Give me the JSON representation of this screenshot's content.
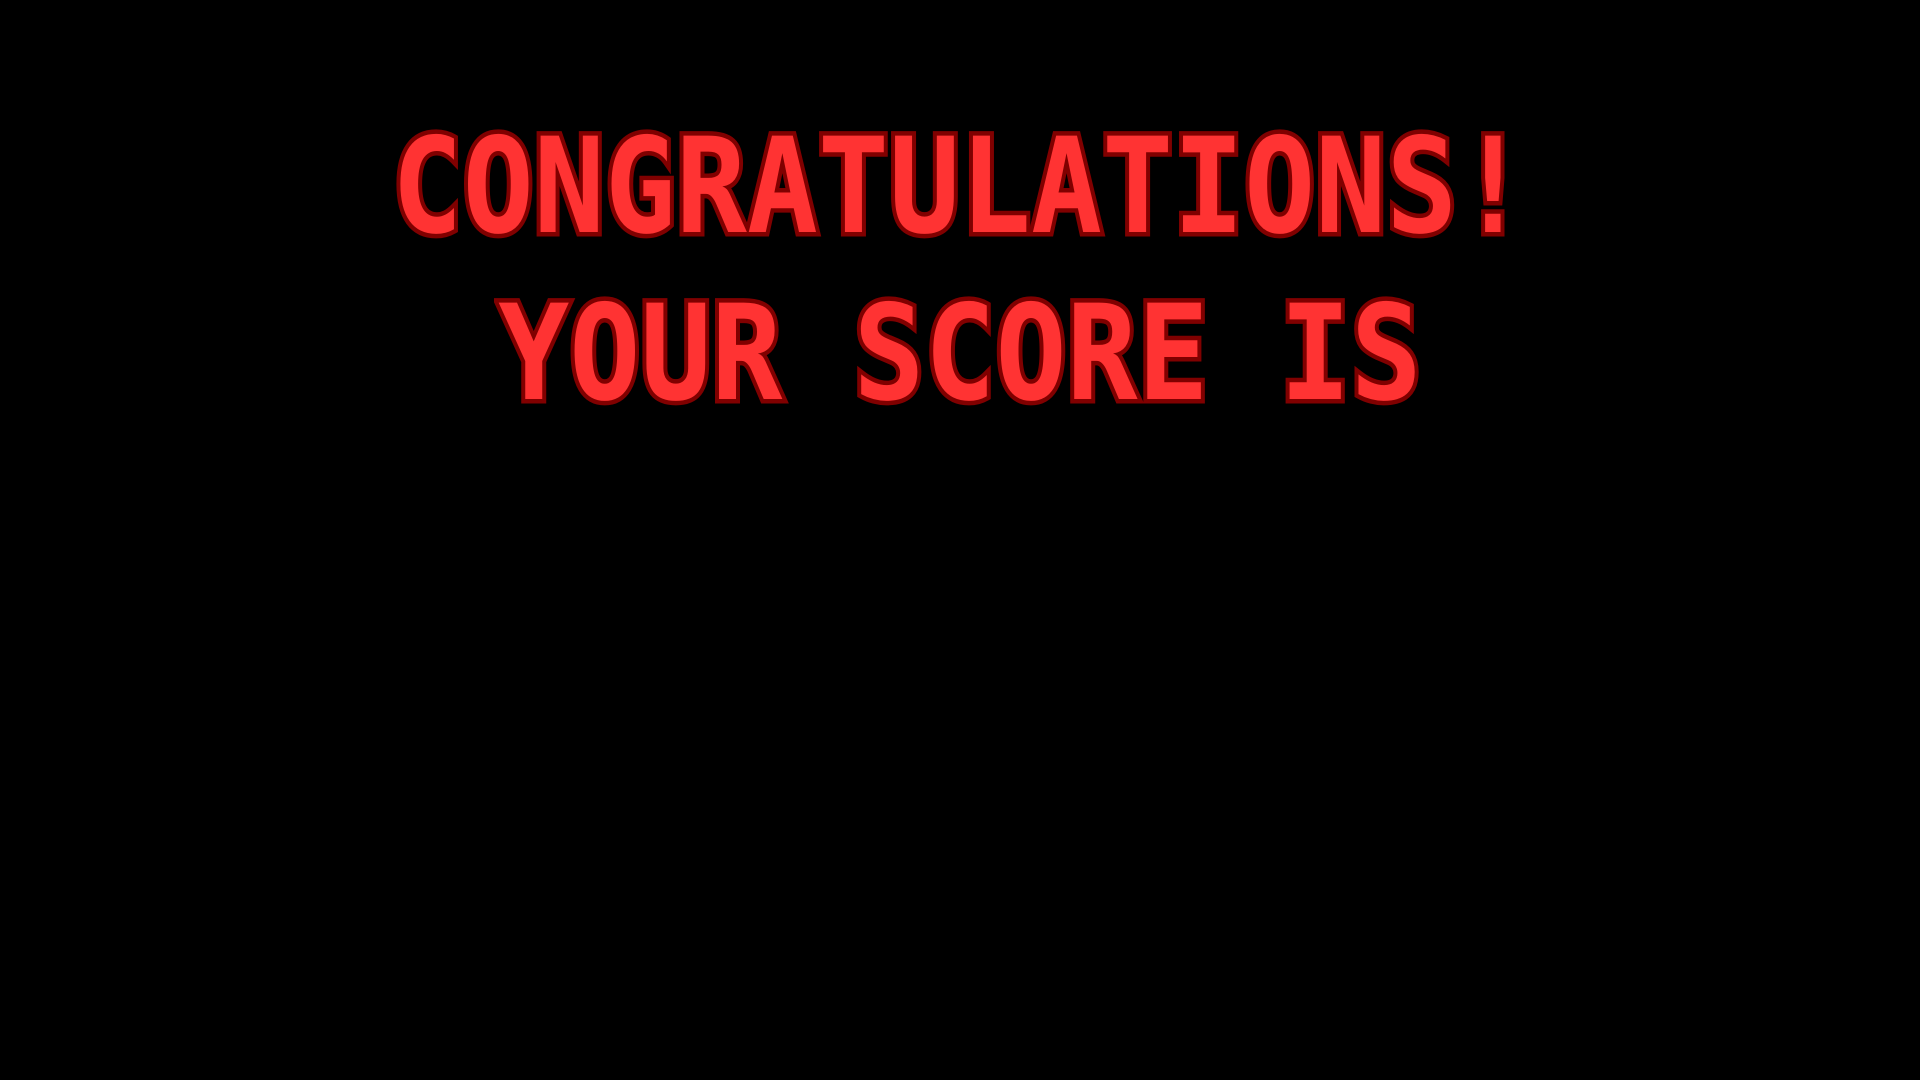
{
  "screen": {
    "headline": "CONGRATULATIONS!",
    "score_label": "YOUR SCORE IS"
  },
  "colors": {
    "background": "#000000",
    "text_fill": "#ff3333",
    "text_outline": "#800000"
  }
}
